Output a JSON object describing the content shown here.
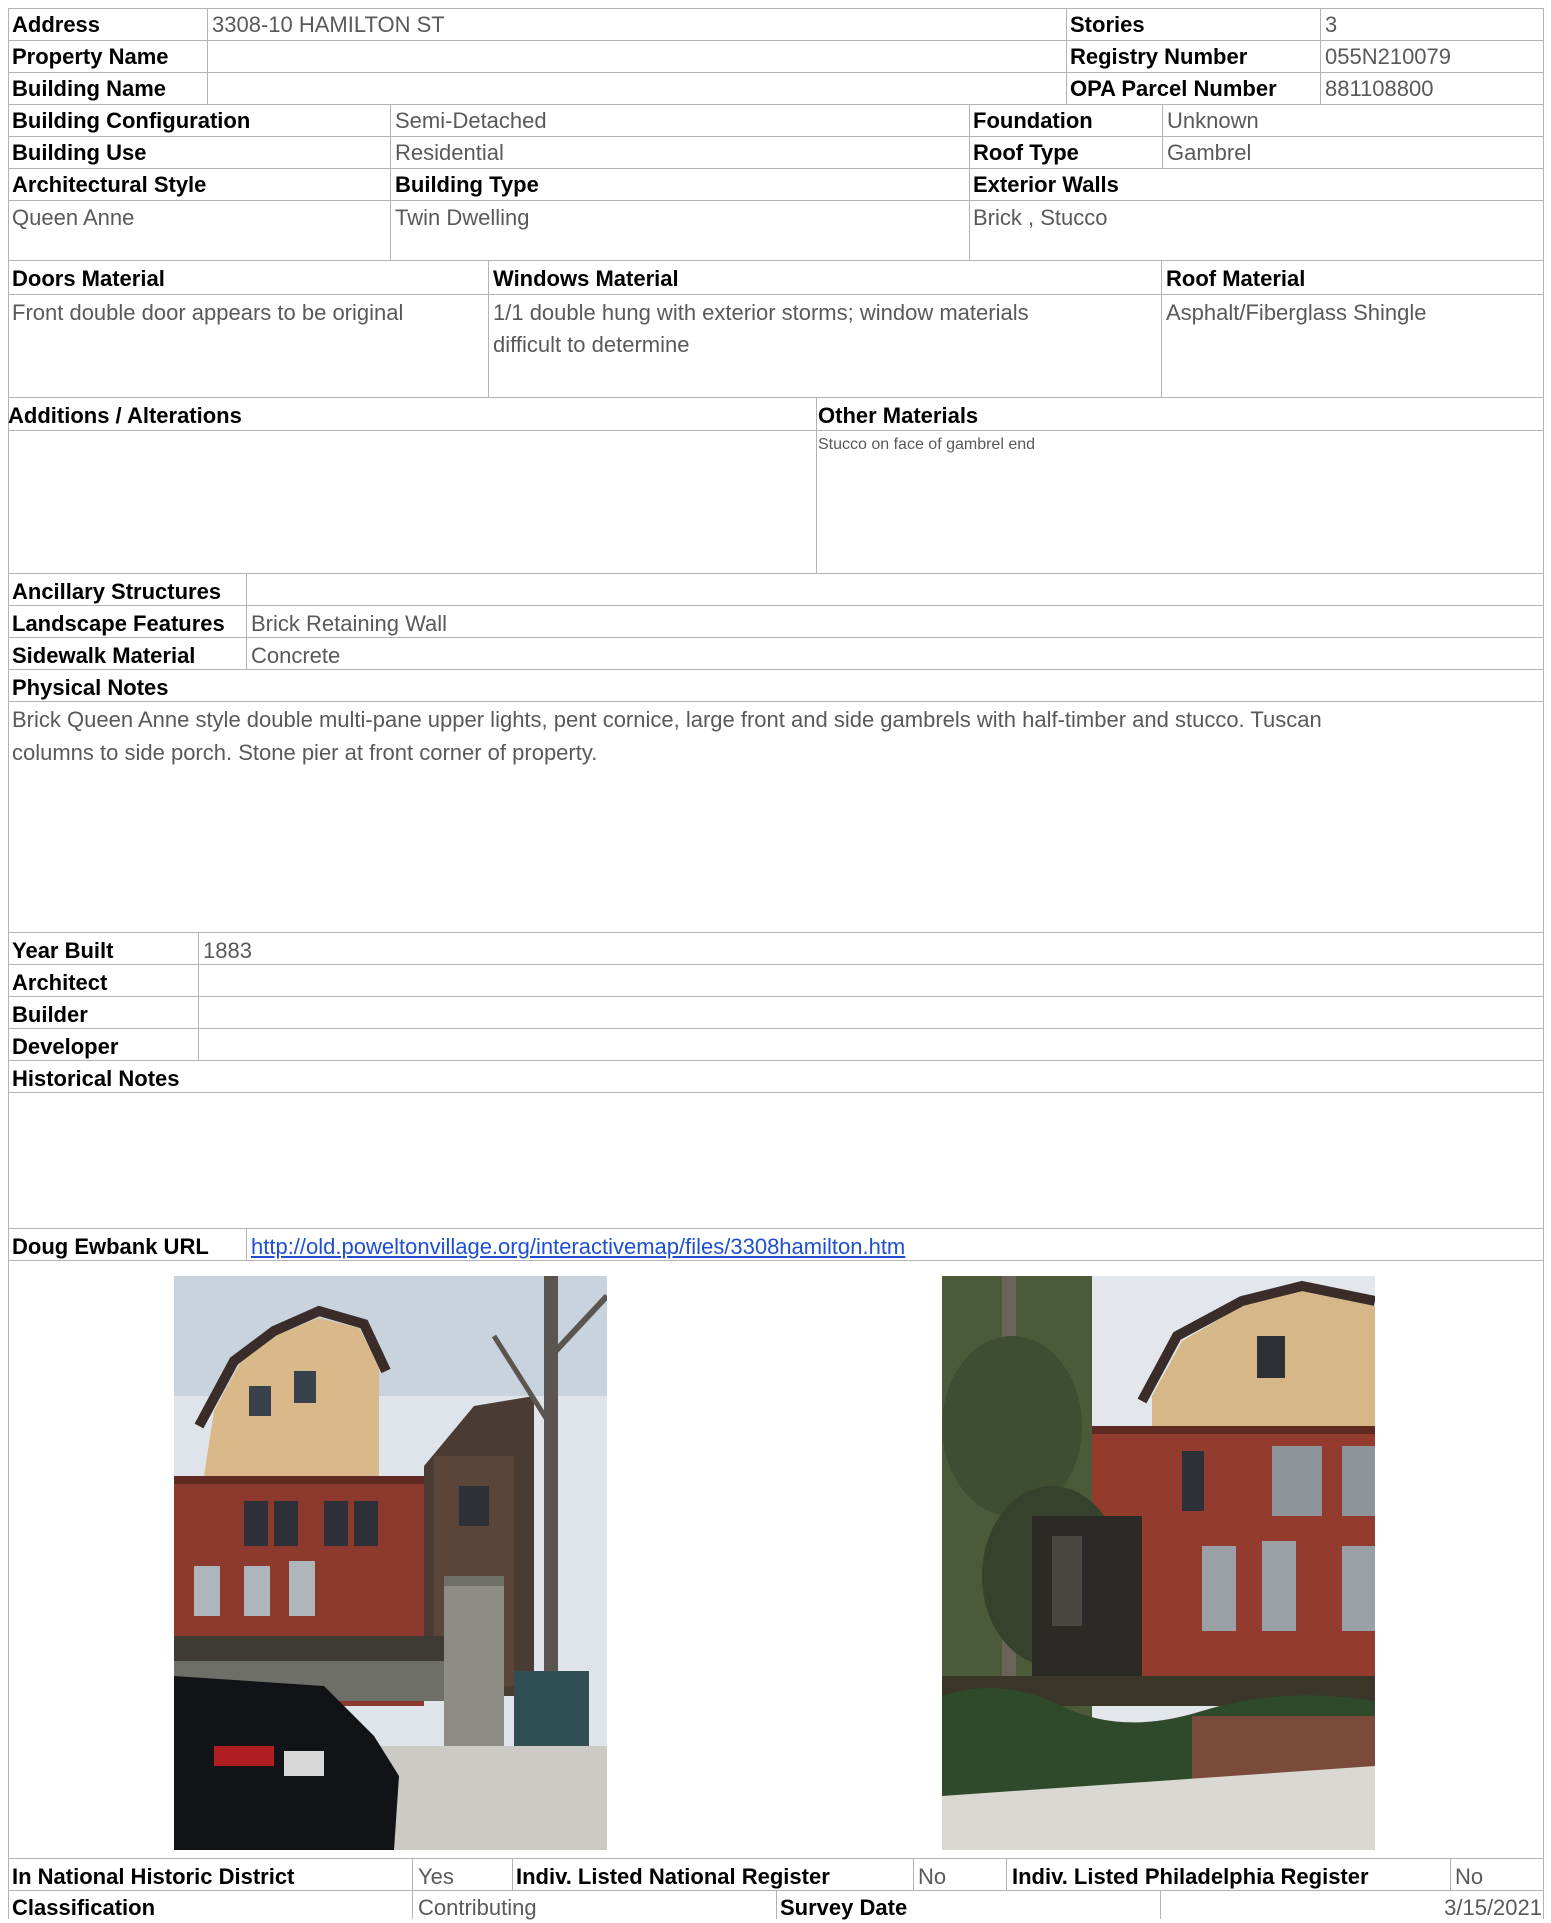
{
  "header": {
    "address_label": "Address",
    "address": "3308-10 HAMILTON ST",
    "property_name_label": "Property Name",
    "property_name": "",
    "building_name_label": "Building Name",
    "building_name": "",
    "stories_label": "Stories",
    "stories": "3",
    "registry_label": "Registry Number",
    "registry": "055N210079",
    "opa_label": "OPA Parcel Number",
    "opa": "881108800"
  },
  "building": {
    "config_label": "Building Configuration",
    "config": "Semi-Detached",
    "use_label": "Building Use",
    "use": "Residential",
    "foundation_label": "Foundation",
    "foundation": "Unknown",
    "roof_type_label": "Roof Type",
    "roof_type": "Gambrel",
    "style_label": "Architectural Style",
    "style": "Queen Anne",
    "type_label": "Building Type",
    "type": "Twin Dwelling",
    "walls_label": "Exterior Walls",
    "walls": "Brick , Stucco"
  },
  "materials": {
    "doors_label": "Doors Material",
    "doors": "Front double door appears to be original",
    "windows_label": "Windows Material",
    "windows_line1": "1/1 double hung with exterior storms; window materials",
    "windows_line2": "difficult to determine",
    "roof_label": "Roof Material",
    "roof": "Asphalt/Fiberglass Shingle",
    "additions_label": "Additions / Alterations",
    "additions": "",
    "other_label": "Other Materials",
    "other": "Stucco on face of gambrel end"
  },
  "site": {
    "ancillary_label": "Ancillary Structures",
    "ancillary": "",
    "landscape_label": "Landscape Features",
    "landscape": "Brick Retaining Wall",
    "sidewalk_label": "Sidewalk Material",
    "sidewalk": "Concrete",
    "physical_label": "Physical Notes",
    "physical_line1": "Brick Queen Anne style double multi-pane upper lights, pent cornice, large front and side gambrels with half-timber and stucco. Tuscan",
    "physical_line2": "columns to side porch. Stone pier at front corner of property."
  },
  "history": {
    "year_label": "Year Built",
    "year": "1883",
    "architect_label": "Architect",
    "architect": "",
    "builder_label": "Builder",
    "builder": "",
    "developer_label": "Developer",
    "developer": "",
    "notes_label": "Historical Notes",
    "notes": "",
    "url_label": "Doug Ewbank URL",
    "url": "http://old.poweltonvillage.org/interactivemap/files/3308hamilton.htm"
  },
  "footer": {
    "district_label": "In National Historic District",
    "district": "Yes",
    "national_label": "Indiv. Listed National Register",
    "national": "No",
    "philly_label": "Indiv. Listed Philadelphia Register",
    "philly": "No",
    "classification_label": "Classification",
    "classification": "Contributing",
    "survey_label": "Survey Date",
    "survey": "3/15/2021"
  }
}
